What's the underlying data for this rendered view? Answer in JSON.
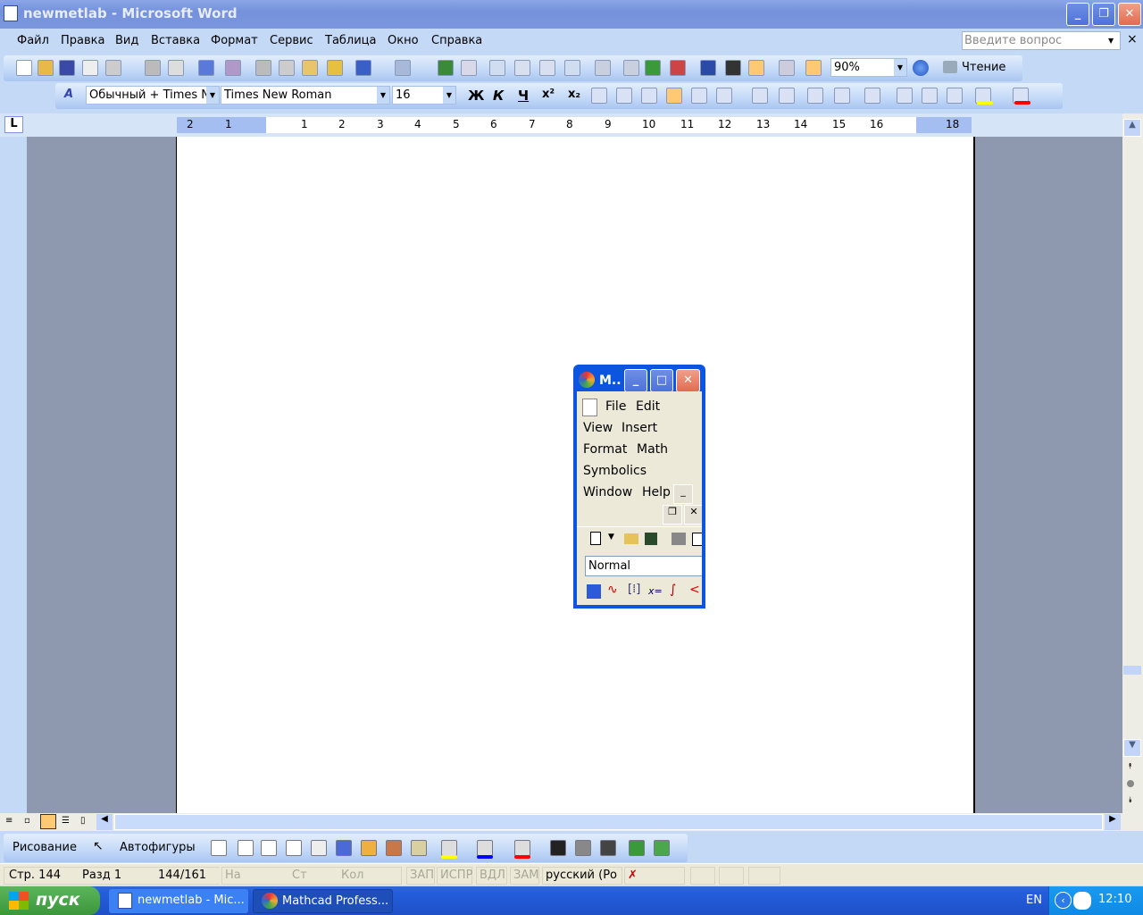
{
  "window": {
    "title": "newmetlab - Microsoft Word",
    "minimize": "_",
    "restore": "❐",
    "close": "✕"
  },
  "menu": {
    "items": [
      "Файл",
      "Правка",
      "Вид",
      "Вставка",
      "Формат",
      "Сервис",
      "Таблица",
      "Окно",
      "Справка"
    ],
    "ask_placeholder": "Введите вопрос",
    "close": "×"
  },
  "standard_toolbar": {
    "zoom": "90%",
    "reading": "Чтение",
    "icons": [
      "new-icon",
      "open-icon",
      "save-icon",
      "permission-icon",
      "email-icon",
      "print-icon",
      "print-preview-icon",
      "spelling-icon",
      "research-icon",
      "cut-icon",
      "copy-icon",
      "paste-icon",
      "format-painter-icon",
      "undo-icon",
      "redo-icon",
      "hyperlink-icon",
      "tables-borders-icon",
      "insert-table-icon",
      "excel-icon",
      "columns-icon",
      "drawing-icon",
      "document-map-icon",
      "show-formatting-icon",
      "help-icon"
    ]
  },
  "formatting_toolbar": {
    "style": "Обычный + Times N",
    "font": "Times New Roman",
    "size": "16",
    "bold": "Ж",
    "italic": "К",
    "underline": "Ч",
    "superscript": "x²",
    "subscript": "x₂",
    "highlight_color": "#FFFF00",
    "font_color": "#FF0000"
  },
  "ruler": {
    "tab_selector": "L",
    "labels": [
      "2",
      "1",
      "",
      "1",
      "2",
      "3",
      "4",
      "5",
      "6",
      "7",
      "8",
      "9",
      "10",
      "11",
      "12",
      "13",
      "14",
      "15",
      "16",
      "",
      "18"
    ]
  },
  "drawing_toolbar": {
    "drawing": "Рисование",
    "autoshapes": "Автофигуры",
    "fill_color": "#FFFF00",
    "line_color": "#0000FF",
    "font_color": "#FF0000"
  },
  "status": {
    "page": "Стр. 144",
    "section": "Разд 1",
    "pages": "144/161",
    "at": "На",
    "line": "Ст",
    "col": "Кол",
    "rec": "ЗАП",
    "trk": "ИСПР",
    "ext": "ВДЛ",
    "ovr": "ЗАМ",
    "language": "русский (Ро"
  },
  "taskbar": {
    "start": "пуск",
    "tasks": [
      "newmetlab - Mic...",
      "Mathcad Profess..."
    ],
    "lang": "EN",
    "clock": "12:10"
  },
  "mathcad": {
    "title": "M..",
    "menu": [
      "File",
      "Edit",
      "View",
      "Insert",
      "Format",
      "Math",
      "Symbolics",
      "Window",
      "Help"
    ],
    "style": "Normal"
  }
}
